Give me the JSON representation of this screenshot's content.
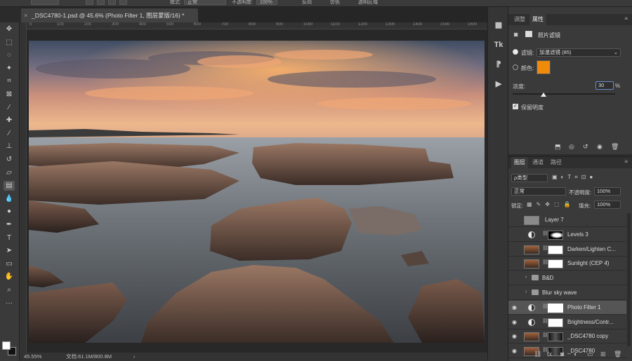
{
  "options_bar": {
    "mode_label": "模式:",
    "mode_value": "正常",
    "opacity_label": "不透明度:",
    "opacity_value": "100%",
    "reverse_label": "反向",
    "dither_label": "仿色",
    "transparency_label": "透明区域"
  },
  "document": {
    "tab_title": "_DSC4780-1.psd @ 45.6% (Photo Filter 1, 图层蒙版/16) *"
  },
  "rulers": {
    "top_ticks": [
      "0",
      "100",
      "200",
      "300",
      "400",
      "500",
      "600",
      "700",
      "800",
      "900",
      "1000",
      "1100",
      "1200",
      "1300",
      "1400",
      "1500",
      "1600"
    ]
  },
  "status": {
    "zoom": "45.55%",
    "doc_size": "文档:61.1M/800.8M",
    "arrow": "›"
  },
  "tools": [
    {
      "icon": "move-icon",
      "glyph": "✥"
    },
    {
      "icon": "marquee-icon",
      "glyph": "⬚"
    },
    {
      "icon": "lasso-icon",
      "glyph": "◌"
    },
    {
      "icon": "magic-wand-icon",
      "glyph": "✦"
    },
    {
      "icon": "crop-icon",
      "glyph": "⌗"
    },
    {
      "icon": "frame-icon",
      "glyph": "⊠"
    },
    {
      "icon": "eyedropper-icon",
      "glyph": "⁄"
    },
    {
      "icon": "healing-brush-icon",
      "glyph": "✚"
    },
    {
      "icon": "brush-icon",
      "glyph": "∕"
    },
    {
      "icon": "clone-stamp-icon",
      "glyph": "⊥"
    },
    {
      "icon": "history-brush-icon",
      "glyph": "↺"
    },
    {
      "icon": "eraser-icon",
      "glyph": "▱"
    },
    {
      "icon": "gradient-icon",
      "glyph": "▤"
    },
    {
      "icon": "blur-icon",
      "glyph": "💧"
    },
    {
      "icon": "dodge-icon",
      "glyph": "●"
    },
    {
      "icon": "pen-icon",
      "glyph": "✒"
    },
    {
      "icon": "type-icon",
      "glyph": "T"
    },
    {
      "icon": "path-selection-icon",
      "glyph": "➤"
    },
    {
      "icon": "shape-icon",
      "glyph": "▭"
    },
    {
      "icon": "hand-icon",
      "glyph": "✋"
    },
    {
      "icon": "zoom-icon",
      "glyph": "⌕"
    },
    {
      "icon": "more-tools-icon",
      "glyph": "···"
    }
  ],
  "dock": [
    "▦",
    "Tk",
    "⁋",
    "▶"
  ],
  "properties": {
    "tab_adjustments": "调整",
    "tab_properties": "属性",
    "panel_title": "照片滤镜",
    "filter_label": "滤镜:",
    "filter_value": "加温滤镜 (85)",
    "color_label": "颜色:",
    "density_label": "浓度:",
    "density_value": "30",
    "density_unit": "%",
    "density_fraction": 0.3,
    "preserve_luminosity": "保留明度",
    "color_swatch": "#ee8a0c"
  },
  "layers_panel": {
    "tabs": [
      "图层",
      "通道",
      "路径"
    ],
    "kind_label": "ρ类型",
    "blend_mode": "正常",
    "opacity_label": "不透明度:",
    "opacity_value": "100%",
    "lock_label": "锁定:",
    "fill_label": "填充:",
    "fill_value": "100%",
    "layers": [
      {
        "name": "Layer 7",
        "visible": false,
        "type": "pixel"
      },
      {
        "name": "Levels 3",
        "visible": false,
        "type": "adjust"
      },
      {
        "name": "Darken/Lighten C...",
        "visible": false,
        "type": "adjust-photo"
      },
      {
        "name": "Sunlight (CEP 4)",
        "visible": false,
        "type": "adjust-photo"
      },
      {
        "name": "B&D",
        "visible": false,
        "type": "group"
      },
      {
        "name": "Blur sky wave",
        "visible": false,
        "type": "group"
      },
      {
        "name": "Photo Filter 1",
        "visible": true,
        "type": "adjust",
        "selected": true
      },
      {
        "name": "Brightness/Contr...",
        "visible": true,
        "type": "adjust"
      },
      {
        "name": "_DSC4780 copy",
        "visible": true,
        "type": "photo"
      },
      {
        "name": "_DSC4780",
        "visible": true,
        "type": "photo"
      }
    ],
    "footer_icons": [
      "link-icon",
      "fx-icon",
      "mask-icon",
      "adjustment-icon",
      "group-icon",
      "new-layer-icon",
      "trash-icon"
    ]
  },
  "colors": {
    "swatch_fg": "#ffffff",
    "swatch_bg": "#111111"
  }
}
